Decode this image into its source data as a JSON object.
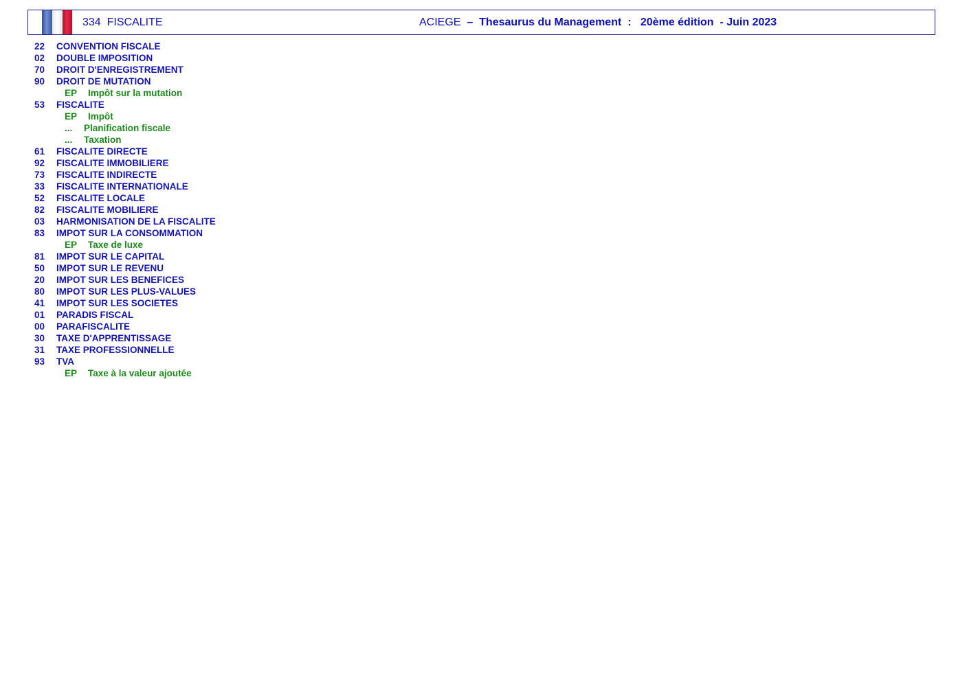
{
  "header": {
    "code": "334",
    "category": "FISCALITE",
    "org": "ACIEGE",
    "dash": "–",
    "publication": "Thesaurus du Management",
    "colon": ":",
    "edition": "20ème édition",
    "date": "- Juin 2023"
  },
  "entries": [
    {
      "num": "22",
      "label": "CONVENTION FISCALE"
    },
    {
      "num": "02",
      "label": "DOUBLE IMPOSITION"
    },
    {
      "num": "70",
      "label": "DROIT D'ENREGISTREMENT"
    },
    {
      "num": "90",
      "label": "DROIT DE MUTATION"
    },
    {
      "tag": "EP",
      "label": "Impôt sur la mutation"
    },
    {
      "num": "53",
      "label": "FISCALITE"
    },
    {
      "tag": "EP",
      "label": "Impôt"
    },
    {
      "tag": "...",
      "label": "Planification fiscale"
    },
    {
      "tag": "...",
      "label": "Taxation"
    },
    {
      "num": "61",
      "label": "FISCALITE DIRECTE"
    },
    {
      "num": "92",
      "label": "FISCALITE IMMOBILIERE"
    },
    {
      "num": "73",
      "label": "FISCALITE INDIRECTE"
    },
    {
      "num": "33",
      "label": "FISCALITE INTERNATIONALE"
    },
    {
      "num": "52",
      "label": "FISCALITE LOCALE"
    },
    {
      "num": "82",
      "label": "FISCALITE MOBILIERE"
    },
    {
      "num": "03",
      "label": "HARMONISATION DE LA FISCALITE"
    },
    {
      "num": "83",
      "label": "IMPOT SUR LA CONSOMMATION"
    },
    {
      "tag": "EP",
      "label": "Taxe de luxe"
    },
    {
      "num": "81",
      "label": "IMPOT SUR LE CAPITAL"
    },
    {
      "num": "50",
      "label": "IMPOT SUR LE REVENU"
    },
    {
      "num": "20",
      "label": "IMPOT SUR LES BENEFICES"
    },
    {
      "num": "80",
      "label": "IMPOT SUR LES PLUS-VALUES"
    },
    {
      "num": "41",
      "label": "IMPOT SUR LES SOCIETES"
    },
    {
      "num": "01",
      "label": "PARADIS FISCAL"
    },
    {
      "num": "00",
      "label": "PARAFISCALITE"
    },
    {
      "num": "30",
      "label": "TAXE D'APPRENTISSAGE"
    },
    {
      "num": "31",
      "label": "TAXE PROFESSIONNELLE"
    },
    {
      "num": "93",
      "label": "TVA"
    },
    {
      "tag": "EP",
      "label": "Taxe à la valeur ajoutée"
    }
  ]
}
